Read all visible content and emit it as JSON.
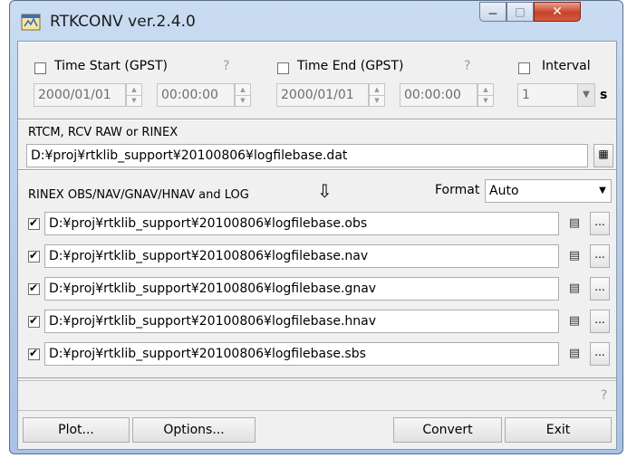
{
  "window": {
    "title": "RTKCONV ver.2.4.0"
  },
  "time": {
    "start_label": "Time Start (GPST)",
    "start_date": "2000/01/01",
    "start_time": "00:00:00",
    "end_label": "Time End (GPST)",
    "end_date": "2000/01/01",
    "end_time": "00:00:00",
    "interval_label": "Interval",
    "interval_value": "1",
    "interval_unit": "s",
    "help_mark": "?"
  },
  "input": {
    "label": "RTCM, RCV RAW or RINEX",
    "path": "D:¥proj¥rtklib_support¥20100806¥logfilebase.dat"
  },
  "output": {
    "label": "RINEX OBS/NAV/GNAV/HNAV and LOG",
    "arrow": "⇩",
    "format_label": "Format",
    "format_value": "Auto",
    "files": [
      {
        "path": "D:¥proj¥rtklib_support¥20100806¥logfilebase.obs",
        "checked": true
      },
      {
        "path": "D:¥proj¥rtklib_support¥20100806¥logfilebase.nav",
        "checked": true
      },
      {
        "path": "D:¥proj¥rtklib_support¥20100806¥logfilebase.gnav",
        "checked": true
      },
      {
        "path": "D:¥proj¥rtklib_support¥20100806¥logfilebase.hnav",
        "checked": true
      },
      {
        "path": "D:¥proj¥rtklib_support¥20100806¥logfilebase.sbs",
        "checked": true
      }
    ],
    "browse_label": "...",
    "view_icon": "doc-view-icon"
  },
  "status": {
    "message": "",
    "help_mark": "?"
  },
  "buttons": {
    "plot": "Plot...",
    "options": "Options...",
    "convert": "Convert",
    "exit": "Exit"
  }
}
